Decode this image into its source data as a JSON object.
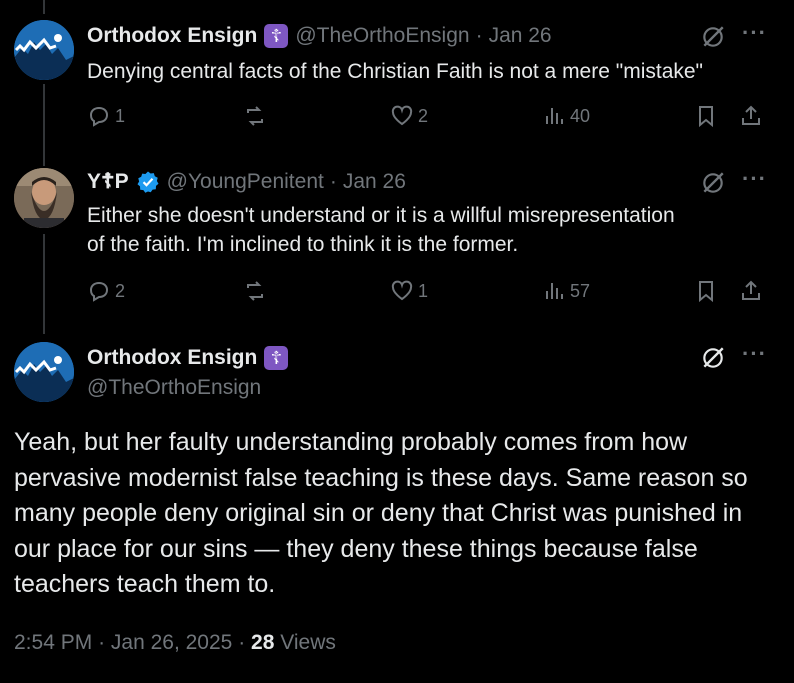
{
  "tweets": [
    {
      "name": "Orthodox Ensign",
      "badge": "☦",
      "handle": "@TheOrthoEnsign",
      "sep": "·",
      "date": "Jan 26",
      "text": [
        "Denying central facts of the Christian Faith is not a mere \"mistake\""
      ],
      "replies": "1",
      "retweets": "",
      "likes": "2",
      "views": "40"
    },
    {
      "name": "Y☦P",
      "handle": "@YoungPenitent",
      "sep": "·",
      "date": "Jan 26",
      "text": [
        "Either she doesn't understand or it is a willful misrepresentation",
        "of the faith.  I'm inclined to think it is the former."
      ],
      "replies": "2",
      "retweets": "",
      "likes": "1",
      "views": "57"
    }
  ],
  "main_tweet": {
    "name": "Orthodox Ensign",
    "badge": "☦",
    "handle": "@TheOrthoEnsign",
    "text": "Yeah, but her faulty understanding probably comes from how pervasive modernist false teaching is these days. Same reason so many people deny original sin or deny that Christ was punished in our place for our sins — they deny these things because false teachers teach them to.",
    "time": "2:54 PM",
    "sep": "·",
    "date": "Jan 26, 2025",
    "views_count": "28",
    "views_label": "Views"
  },
  "icons": {
    "reply": "reply-icon",
    "retweet": "retweet-icon",
    "like": "heart-icon",
    "views": "analytics-icon",
    "bookmark": "bookmark-icon",
    "share": "share-icon",
    "grok": "grok-icon",
    "more": "more-icon"
  },
  "colors": {
    "background": "#000000",
    "text": "#e7e9ea",
    "muted": "#71767b",
    "verified": "#1d9bf0",
    "badge": "#7e57c2"
  }
}
